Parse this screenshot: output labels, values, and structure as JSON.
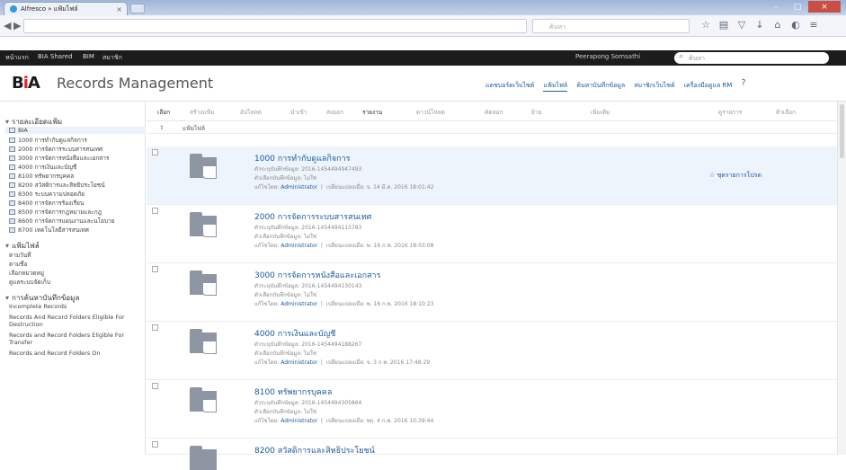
{
  "browser": {
    "tab_title": "Alfresco » แฟ้มไฟล์",
    "search_placeholder": "ค้นหา"
  },
  "appbar": {
    "links": [
      "หน้าแรก",
      "BIA Shared",
      "BIM",
      "สมาชิก"
    ],
    "user": "Peerapong Somsathi",
    "search_placeholder": "ค้นหา"
  },
  "header": {
    "logo_a": "B",
    "logo_b": "i",
    "logo_c": "A",
    "title": "Records Management",
    "nav": [
      "แดชบอร์ดเว็บไซต์",
      "แฟ้มไฟล์",
      "ค้นหาบันทึกข้อมูล",
      "สมาชิกเว็บไซต์",
      "เครื่องมือดูแล RM"
    ],
    "help": "?"
  },
  "sidebar": {
    "section1": "รายละเอียดแฟ้ม",
    "root": "BIA",
    "items": [
      "1000 การทำกับดูแลกิจการ",
      "2000 การจัดการระบบสารสนเทศ",
      "3000 การจัดการหนังสือและเอกสาร",
      "4000 การเงินและบัญชี",
      "8100 ทรัพยากรบุคคล",
      "8200 สวัสดิการและสิทธิประโยชน์",
      "8300 ระบบความปลอดภัย",
      "8400 การจัดการร้องเรียน",
      "8500 การจัดการกฎหมายและกฎ",
      "8600 การจัดการแผนงานและนโยบาย",
      "8700 เทคโนโลยีสารสนเทศ"
    ],
    "section2": "แฟ้มไฟล์",
    "sub2": [
      "ตามวันที่",
      "ตามชื่อ",
      "เลือกหมวดหมู่",
      "ดูแลระบบจัดเก็บ"
    ],
    "section3": "การค้นหาบันทึกข้อมูล",
    "sub3": [
      "Incomplete Records",
      "Records And Record Folders Eligible For Destruction",
      "Records and Record Folders Eligible For Transfer",
      "Records and Record Folders On"
    ]
  },
  "toolbar": {
    "items": [
      "เลือก",
      "สร้างแฟ้ม",
      "อัปโหลด",
      "นำเข้า",
      "ส่งออก",
      "รายงาน",
      "ดาวน์โหลด",
      "คัดลอก",
      "ย้าย",
      "เพิ่มเติม",
      "ดูรายการ",
      "ตัวเลือก"
    ]
  },
  "breadcrumb": {
    "up": "⇧",
    "path": "แฟ้มไฟล์"
  },
  "rows": [
    {
      "title": "1000 การทำกับดูแลกิจการ",
      "line1": "ตัวระบุบันทึกข้อมูล: 2016-1454494947493",
      "line2": "ตัวเลือกบันทึกข้อมูล: ไม่ใช่",
      "modifier_prefix": "แก้ไขโดย:",
      "modifier": "Administrator",
      "modified": "เปลี่ยนแปลงเมื่อ: จ. 14 มี.ค. 2016 18:01:42",
      "fav": "☆ ชุดรายการโปรด"
    },
    {
      "title": "2000 การจัดการระบบสารสนเทศ",
      "line1": "ตัวระบุบันทึกข้อมูล: 2016-1454494115783",
      "line2": "ตัวเลือกบันทึกข้อมูล: ไม่ใช่",
      "modifier_prefix": "แก้ไขโดย:",
      "modifier": "Administrator",
      "modified": "เปลี่ยนแปลงเมื่อ: พ. 16 ก.พ. 2016 18:03:08",
      "fav": ""
    },
    {
      "title": "3000 การจัดการหนังสือและเอกสาร",
      "line1": "ตัวระบุบันทึกข้อมูล: 2016-1454494130143",
      "line2": "ตัวเลือกบันทึกข้อมูล: ไม่ใช่",
      "modifier_prefix": "แก้ไขโดย:",
      "modifier": "Administrator",
      "modified": "เปลี่ยนแปลงเมื่อ: พ. 16 ก.พ. 2016 18:10:23",
      "fav": ""
    },
    {
      "title": "4000 การเงินและบัญชี",
      "line1": "ตัวระบุบันทึกข้อมูล: 2016-1454494188267",
      "line2": "ตัวเลือกบันทึกข้อมูล: ไม่ใช่",
      "modifier_prefix": "แก้ไขโดย:",
      "modifier": "Administrator",
      "modified": "เปลี่ยนแปลงเมื่อ: จ. 3 ก.พ. 2016 17:48:29",
      "fav": ""
    },
    {
      "title": "8100 ทรัพยากรบุคคล",
      "line1": "ตัวระบุบันทึกข้อมูล: 2016-1454494305864",
      "line2": "ตัวเลือกบันทึกข้อมูล: ไม่ใช่",
      "modifier_prefix": "แก้ไขโดย:",
      "modifier": "Administrator",
      "modified": "เปลี่ยนแปลงเมื่อ: พฤ. 4 ก.พ. 2016 10:39:44",
      "fav": ""
    },
    {
      "title": "8200 สวัสดิการและสิทธิประโยชน์",
      "line1": "",
      "line2": "",
      "modifier_prefix": "",
      "modifier": "",
      "modified": "",
      "fav": ""
    }
  ]
}
